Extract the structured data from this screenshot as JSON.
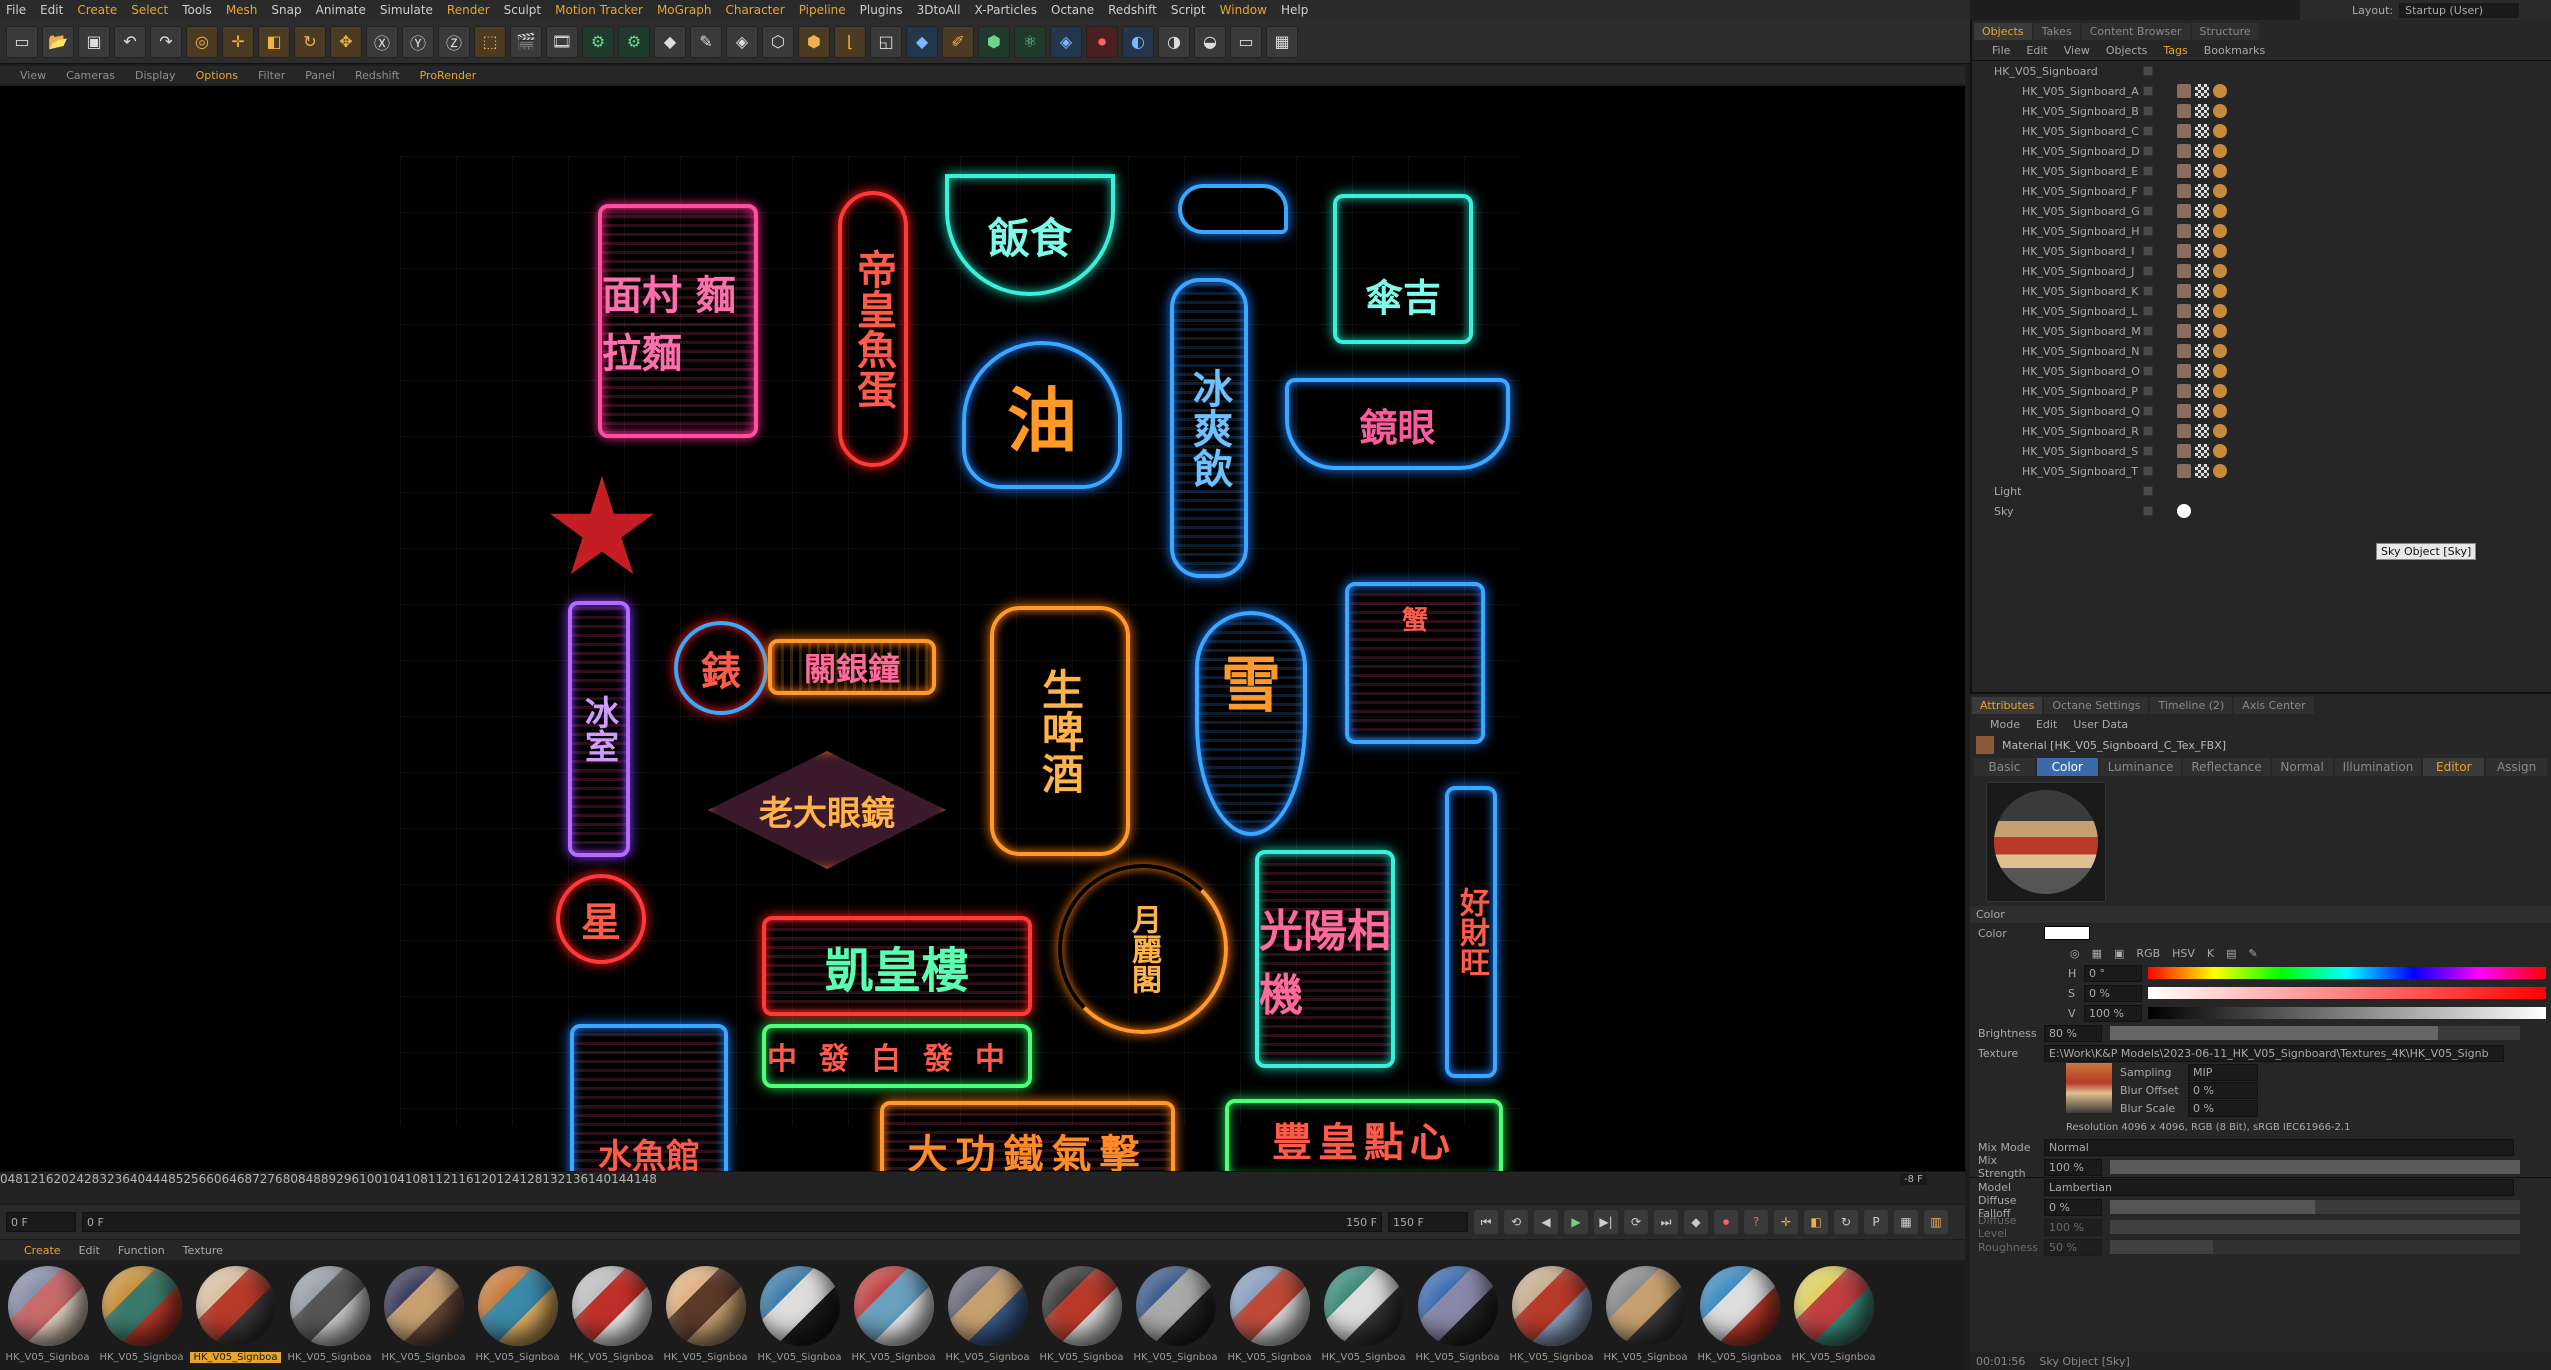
{
  "menubar": {
    "items": [
      "File",
      "Edit",
      "Create",
      "Select",
      "Tools",
      "Mesh",
      "Snap",
      "Animate",
      "Simulate",
      "Render",
      "Sculpt",
      "Motion Tracker",
      "MoGraph",
      "Character",
      "Pipeline",
      "Plugins",
      "3DtoAll",
      "X-Particles",
      "Octane",
      "Redshift",
      "Script",
      "Window",
      "Help"
    ]
  },
  "layout": {
    "label": "Layout:",
    "value": "Startup (User)"
  },
  "viewport": {
    "menu": [
      "View",
      "Cameras",
      "Display",
      "Options",
      "Filter",
      "Panel",
      "Redshift",
      "ProRender"
    ]
  },
  "signs": {
    "s1": "面村 麵 拉麵",
    "s2": "帝皇魚蛋",
    "s3": "飯食",
    "s4": "冰爽飲",
    "s5": "傘吉",
    "s6": "油",
    "s7": "鏡眼",
    "s8": "錶",
    "s9": "關銀鐘",
    "s10": "冰室",
    "s11": "生啤酒",
    "s12": "雪",
    "s13": "蟹",
    "s14": "老大眼鏡",
    "s15": "凱皇樓",
    "s16": "月麗閣",
    "s17": "光陽相機",
    "s18": "好財旺",
    "s19": "中發白發中",
    "s20": "水魚館",
    "s21": "大功鐵氣擊",
    "s22": "豐皇點心",
    "s23": "星"
  },
  "timeline": {
    "ticks": [
      "0",
      "4",
      "8",
      "12",
      "16",
      "20",
      "24",
      "28",
      "32",
      "36",
      "40",
      "44",
      "48",
      "52",
      "56",
      "60",
      "64",
      "68",
      "72",
      "76",
      "80",
      "84",
      "88",
      "92",
      "96",
      "100",
      "104",
      "108",
      "112",
      "116",
      "120",
      "124",
      "128",
      "132",
      "136",
      "140",
      "144",
      "148"
    ],
    "current": "-8 F",
    "start": "0 F",
    "start2": "0 F",
    "end": "150 F",
    "end2": "150 F"
  },
  "materials": {
    "menu": [
      "Create",
      "Edit",
      "Function",
      "Texture"
    ],
    "items": [
      "HK_V05_Signboa",
      "HK_V05_Signboa",
      "HK_V05_Signboa",
      "HK_V05_Signboa",
      "HK_V05_Signboa",
      "HK_V05_Signboa",
      "HK_V05_Signboa",
      "HK_V05_Signboa",
      "HK_V05_Signboa",
      "HK_V05_Signboa",
      "HK_V05_Signboa",
      "HK_V05_Signboa",
      "HK_V05_Signboa",
      "HK_V05_Signboa",
      "HK_V05_Signboa",
      "HK_V05_Signboa",
      "HK_V05_Signboa",
      "HK_V05_Signboa",
      "HK_V05_Signboa",
      "HK_V05_Signboa"
    ],
    "selected_index": 2
  },
  "objects": {
    "tabs": [
      "Objects",
      "Takes",
      "Content Browser",
      "Structure"
    ],
    "menu": [
      "File",
      "Edit",
      "View",
      "Objects",
      "Tags",
      "Bookmarks"
    ],
    "rows": [
      "HK_V05_Signboard",
      "HK_V05_Signboard_A",
      "HK_V05_Signboard_B",
      "HK_V05_Signboard_C",
      "HK_V05_Signboard_D",
      "HK_V05_Signboard_E",
      "HK_V05_Signboard_F",
      "HK_V05_Signboard_G",
      "HK_V05_Signboard_H",
      "HK_V05_Signboard_I",
      "HK_V05_Signboard_J",
      "HK_V05_Signboard_K",
      "HK_V05_Signboard_L",
      "HK_V05_Signboard_M",
      "HK_V05_Signboard_N",
      "HK_V05_Signboard_O",
      "HK_V05_Signboard_P",
      "HK_V05_Signboard_Q",
      "HK_V05_Signboard_R",
      "HK_V05_Signboard_S",
      "HK_V05_Signboard_T",
      "Light",
      "Sky"
    ],
    "tooltip": "Sky Object [Sky]"
  },
  "attributes": {
    "tabs": [
      "Attributes",
      "Octane Settings",
      "Timeline (2)",
      "Axis Center"
    ],
    "menu": [
      "Mode",
      "Edit",
      "User Data"
    ],
    "title": "Material [HK_V05_Signboard_C_Tex_FBX]",
    "chan_tabs": [
      "Basic",
      "Color",
      "Luminance",
      "Reflectance",
      "Normal",
      "Illumination",
      "Editor",
      "Assign"
    ],
    "section": "Color",
    "color_label": "Color",
    "h_label": "H",
    "h_val": "0 °",
    "s_label": "S",
    "s_val": "0 %",
    "v_label": "V",
    "v_val": "100 %",
    "brightness_label": "Brightness",
    "brightness_val": "80 %",
    "texture_label": "Texture",
    "texture_path": "E:\\Work\\K&P Models\\2023-06-11_HK_V05_Signboard\\Textures_4K\\HK_V05_Signb",
    "sampling_label": "Sampling",
    "sampling_val": "MIP",
    "blur_offset_label": "Blur Offset",
    "blur_offset_val": "0 %",
    "blur_scale_label": "Blur Scale",
    "blur_scale_val": "0 %",
    "resolution": "Resolution 4096 x 4096, RGB (8 Bit), sRGB IEC61966-2.1",
    "mix_mode_label": "Mix Mode",
    "mix_mode_val": "Normal",
    "mix_strength_label": "Mix Strength",
    "mix_strength_val": "100 %",
    "model_label": "Model",
    "model_val": "Lambertian",
    "diffuse_falloff_label": "Diffuse Falloff",
    "diffuse_falloff_val": "0 %",
    "diffuse_level_label": "Diffuse Level",
    "diffuse_level_val": "100 %",
    "roughness_label": "Roughness",
    "roughness_val": "50 %"
  },
  "status": {
    "time": "00:01:56",
    "message": "Sky Object [Sky]"
  }
}
